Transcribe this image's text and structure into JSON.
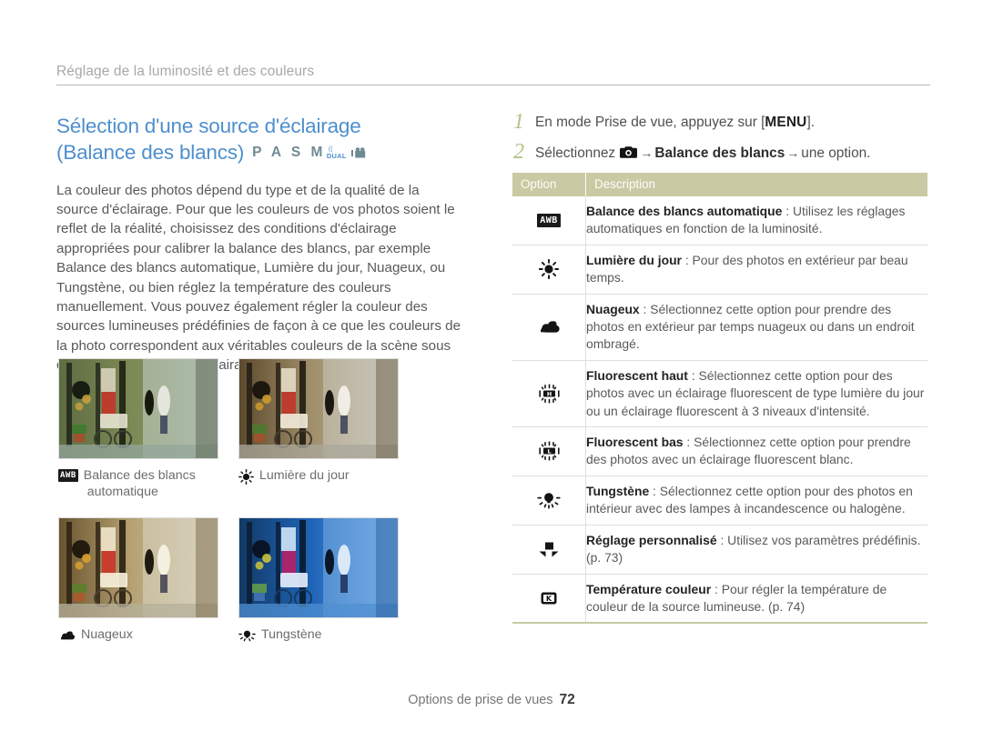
{
  "running_head": "Réglage de la luminosité et des couleurs",
  "section": {
    "title_line1": "Sélection d'une source d'éclairage",
    "title_line2": "(Balance des blancs)",
    "modes": "P A S M",
    "mode_dual_top": "((",
    "mode_dual_label": "DUAL",
    "body": "La couleur des photos dépend du type et de la qualité de la source d'éclairage. Pour que les couleurs de vos photos soient le reflet de la réalité, choisissez des conditions d'éclairage appropriées pour calibrer la balance des blancs, par exemple Balance des blancs automatique, Lumière du jour, Nuageux, ou Tungstène, ou bien réglez la température des couleurs manuellement. Vous pouvez également régler la couleur des sources lumineuses prédéfinies de façon à ce que les couleurs de la photo correspondent aux véritables couleurs de la scène sous différentes conditions d'éclairage."
  },
  "samples": [
    {
      "icon": "awb-icon",
      "caption_line1": "Balance des blancs",
      "caption_line2": "automatique"
    },
    {
      "icon": "daylight-icon",
      "caption_line1": "Lumière du jour",
      "caption_line2": ""
    },
    {
      "icon": "cloudy-icon",
      "caption_line1": "Nuageux",
      "caption_line2": ""
    },
    {
      "icon": "tungsten-icon",
      "caption_line1": "Tungstène",
      "caption_line2": ""
    }
  ],
  "steps": [
    {
      "num": "1",
      "pre": "En mode Prise de vue, appuyez sur [",
      "kbd": "MENU",
      "post": "]."
    },
    {
      "num": "2",
      "pre": "Sélectionnez",
      "mid": "Balance des blancs",
      "post": "une option."
    }
  ],
  "table": {
    "headers": {
      "option": "Option",
      "description": "Description"
    },
    "rows": [
      {
        "icon": "awb-icon",
        "term": "Balance des blancs automatique",
        "sep": " : ",
        "desc": "Utilisez les réglages automatiques en fonction de la luminosité."
      },
      {
        "icon": "daylight-icon",
        "term": "Lumière du jour",
        "sep": " : ",
        "desc": "Pour des photos en extérieur par beau temps."
      },
      {
        "icon": "cloudy-icon",
        "term": "Nuageux",
        "sep": " : ",
        "desc": "Sélectionnez cette option pour prendre des photos en extérieur par temps nuageux ou dans un endroit ombragé."
      },
      {
        "icon": "fluorescent-high-icon",
        "term": "Fluorescent haut",
        "sep": " : ",
        "desc": "Sélectionnez cette option pour des photos avec un éclairage fluorescent de type lumière du jour ou un éclairage fluorescent à 3 niveaux d'intensité."
      },
      {
        "icon": "fluorescent-low-icon",
        "term": "Fluorescent bas",
        "sep": " : ",
        "desc": "Sélectionnez cette option pour prendre des photos avec un éclairage fluorescent blanc."
      },
      {
        "icon": "tungsten-icon",
        "term": "Tungstène",
        "sep": " : ",
        "desc": "Sélectionnez cette option pour des photos en intérieur avec des lampes à incandescence ou halogène."
      },
      {
        "icon": "custom-setting-icon",
        "term": "Réglage personnalisé",
        "sep": " : ",
        "desc": "Utilisez vos paramètres prédéfinis. (p. 73)"
      },
      {
        "icon": "color-temperature-icon",
        "term": "Température couleur",
        "sep": " : ",
        "desc": "Pour régler la température de couleur de la source lumineuse. (p. 74)"
      }
    ]
  },
  "footer": {
    "label": "Options de prise de vues",
    "page": "72"
  },
  "colors": {
    "heading_blue": "#4e8fcd",
    "table_header": "#c9c9a4",
    "step_number": "#b2c48c",
    "mode_icons": "#6f8b92",
    "body_text": "#59595b"
  }
}
